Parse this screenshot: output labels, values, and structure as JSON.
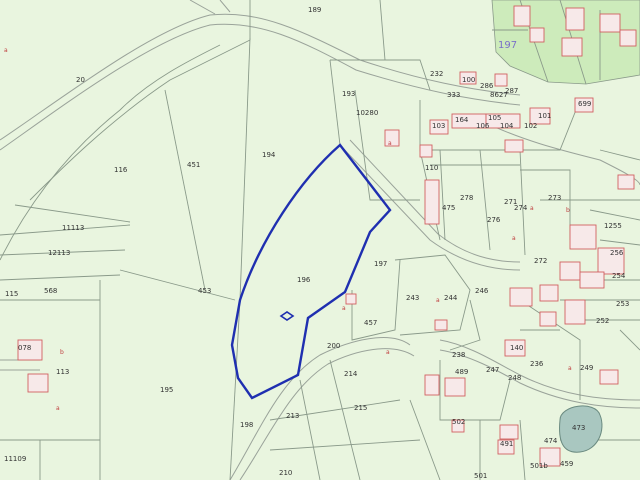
{
  "map": {
    "colors": {
      "background": "#e9f5df",
      "zone": "#cdebbb",
      "highlight": "#1f2fb0",
      "building": "#d06060",
      "pond": "#a9c7c0"
    },
    "zone_label": "197",
    "highlight_label": "196",
    "parcels": [
      "189",
      "20",
      "116",
      "451",
      "194",
      "193",
      "10280",
      "232",
      "100",
      "286",
      "8627",
      "287",
      "333",
      "699",
      "103",
      "164",
      "105",
      "106",
      "104",
      "102",
      "101",
      "110",
      "278",
      "475",
      "276",
      "271",
      "274",
      "273",
      "1255",
      "115",
      "12113",
      "11113",
      "568",
      "453",
      "196",
      "197",
      "243",
      "244",
      "246",
      "272",
      "256",
      "254",
      "253",
      "252",
      "113",
      "078",
      "195",
      "200",
      "214",
      "457",
      "238",
      "489",
      "247",
      "248",
      "236",
      "249",
      "140",
      "215",
      "213",
      "198",
      "210",
      "11109",
      "502",
      "501",
      "473",
      "474",
      "491",
      "501b",
      "459"
    ],
    "markers": [
      "a",
      "b"
    ]
  }
}
